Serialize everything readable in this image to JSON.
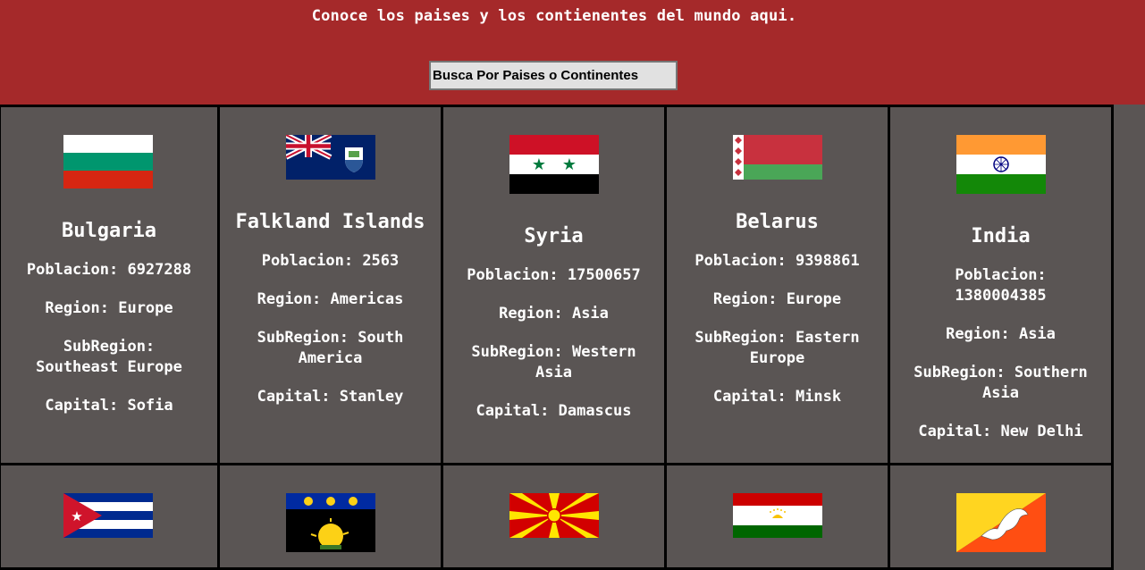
{
  "header": {
    "title": "Conoce los paises y los contienentes del mundo aqui.",
    "search_placeholder": "Busca Por Paises o Continentes"
  },
  "colors": {
    "header_bg": "#a5292a",
    "card_bg": "#5a5554",
    "card_border": "#000000",
    "search_bg": "#e1e1e1"
  },
  "countries": [
    {
      "name": "Bulgaria",
      "poblacion": "Poblacion: 6927288",
      "region": "Region: Europe",
      "subregion": "SubRegion: Southeast Europe",
      "capital": "Capital: Sofia",
      "flag_icon": "bulgaria-flag"
    },
    {
      "name": "Falkland Islands",
      "poblacion": "Poblacion: 2563",
      "region": "Region: Americas",
      "subregion": "SubRegion: South America",
      "capital": "Capital: Stanley",
      "flag_icon": "falkland-islands-flag"
    },
    {
      "name": "Syria",
      "poblacion": "Poblacion: 17500657",
      "region": "Region: Asia",
      "subregion": "SubRegion: Western Asia",
      "capital": "Capital: Damascus",
      "flag_icon": "syria-flag"
    },
    {
      "name": "Belarus",
      "poblacion": "Poblacion: 9398861",
      "region": "Region: Europe",
      "subregion": "SubRegion: Eastern Europe",
      "capital": "Capital: Minsk",
      "flag_icon": "belarus-flag"
    },
    {
      "name": "India",
      "poblacion": "Poblacion: 1380004385",
      "region": "Region: Asia",
      "subregion": "SubRegion: Southern Asia",
      "capital": "Capital: New Delhi",
      "flag_icon": "india-flag"
    }
  ],
  "second_row_flags": [
    "cuba-flag",
    "guadeloupe-flag",
    "north-macedonia-flag",
    "tajikistan-flag",
    "bhutan-flag"
  ]
}
